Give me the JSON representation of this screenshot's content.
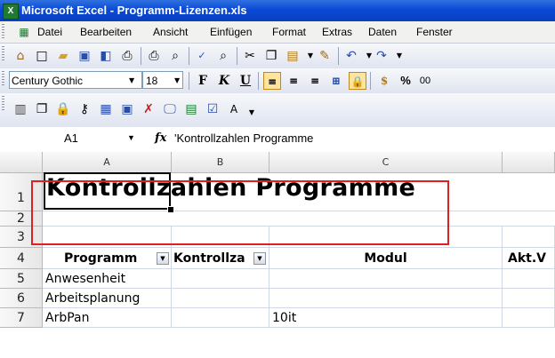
{
  "window": {
    "title": "Microsoft Excel - Programm-Lizenzen.xls"
  },
  "menu": [
    "Datei",
    "Bearbeiten",
    "Ansicht",
    "Einfügen",
    "Format",
    "Extras",
    "Daten",
    "Fenster"
  ],
  "format_toolbar": {
    "font": "Century Gothic",
    "size": "18",
    "bold": "F",
    "italic": "K",
    "underline": "U",
    "percent": "%",
    "zeros": "00"
  },
  "formula_bar": {
    "name_box": "A1",
    "fx": "fx",
    "content": "'Kontrollzahlen Programme"
  },
  "columns": [
    "A",
    "B",
    "C"
  ],
  "rows": [
    "1",
    "2",
    "3",
    "4",
    "5",
    "6",
    "7"
  ],
  "sheet": {
    "title": "Kontrollzahlen Programme",
    "headers": [
      "Programm",
      "Kontrollza",
      "Modul",
      "Akt.V"
    ],
    "data": [
      [
        "Anwesenheit",
        "",
        ""
      ],
      [
        "Arbeitsplanung",
        "",
        ""
      ],
      [
        "ArbPan",
        "",
        "10it"
      ]
    ]
  },
  "colors": {
    "accent": "#0b4ad6",
    "highlight": "#e02020"
  }
}
